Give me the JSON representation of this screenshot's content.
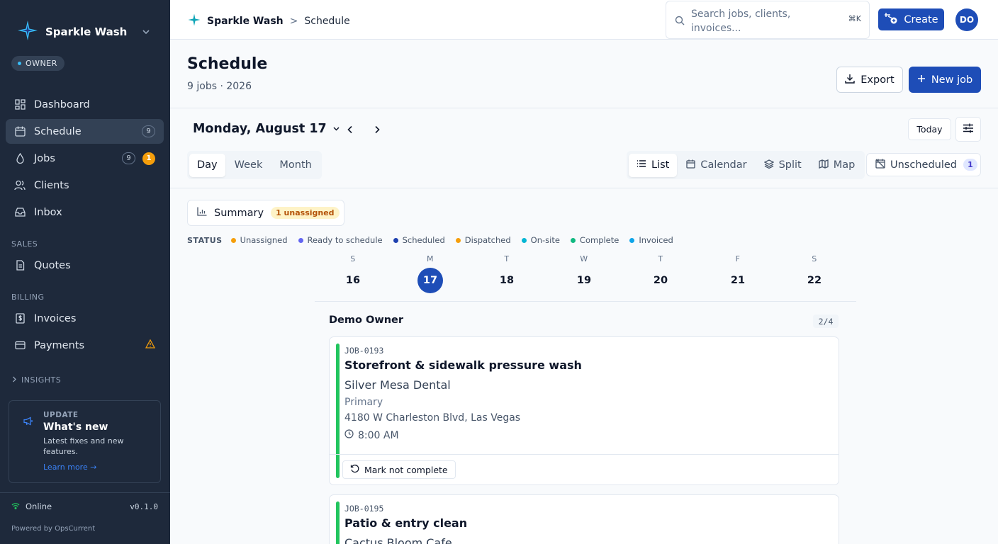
{
  "app": {
    "name": "Sparkle Wash",
    "role": "OWNER"
  },
  "sidebar": {
    "nav": [
      {
        "label": "Dashboard",
        "icon": "dashboard-icon"
      },
      {
        "label": "Schedule",
        "icon": "calendar-icon",
        "count": "9",
        "active": true
      },
      {
        "label": "Jobs",
        "icon": "droplet-icon",
        "count": "9",
        "alert": "1"
      },
      {
        "label": "Clients",
        "icon": "users-icon"
      },
      {
        "label": "Inbox",
        "icon": "inbox-icon"
      }
    ],
    "sales_label": "SALES",
    "sales": [
      {
        "label": "Quotes",
        "icon": "document-icon"
      }
    ],
    "billing_label": "BILLING",
    "billing": [
      {
        "label": "Invoices",
        "icon": "dollar-file-icon"
      },
      {
        "label": "Payments",
        "icon": "credit-card-icon",
        "warning": true
      }
    ],
    "insights_label": "INSIGHTS",
    "update": {
      "tag": "UPDATE",
      "title": "What's new",
      "desc": "Latest fixes and new features.",
      "link": "Learn more →"
    },
    "status": "Online",
    "version": "v0.1.0",
    "powered": "Powered by OpsCurrent"
  },
  "topbar": {
    "breadcrumb_app": "Sparkle Wash",
    "breadcrumb_sep": ">",
    "breadcrumb_page": "Schedule",
    "search_placeholder": "Search jobs, clients, invoices...",
    "search_kbd": "⌘K",
    "create_label": "Create",
    "avatar": "DO"
  },
  "page": {
    "title": "Schedule",
    "subtitle": "9 jobs · 2026",
    "export_label": "Export",
    "new_job_label": "New job"
  },
  "toolbar": {
    "date_label": "Monday, August 17",
    "today_label": "Today",
    "range_tabs": [
      "Day",
      "Week",
      "Month"
    ],
    "view_tabs": [
      "List",
      "Calendar",
      "Split",
      "Map"
    ],
    "unscheduled_label": "Unscheduled",
    "unscheduled_count": "1"
  },
  "summary": {
    "label": "Summary",
    "badge": "1 unassigned"
  },
  "legend": {
    "title": "STATUS",
    "items": [
      {
        "label": "Unassigned",
        "color": "#f59e0b"
      },
      {
        "label": "Ready to schedule",
        "color": "#6366f1"
      },
      {
        "label": "Scheduled",
        "color": "#1e40af"
      },
      {
        "label": "Dispatched",
        "color": "#f59e0b"
      },
      {
        "label": "On-site",
        "color": "#06b6d4"
      },
      {
        "label": "Complete",
        "color": "#10b981"
      },
      {
        "label": "Invoiced",
        "color": "#0ea5e9"
      }
    ]
  },
  "week": [
    {
      "letter": "S",
      "num": "16"
    },
    {
      "letter": "M",
      "num": "17",
      "selected": true
    },
    {
      "letter": "T",
      "num": "18"
    },
    {
      "letter": "W",
      "num": "19"
    },
    {
      "letter": "T",
      "num": "20"
    },
    {
      "letter": "F",
      "num": "21"
    },
    {
      "letter": "S",
      "num": "22"
    }
  ],
  "group": {
    "name": "Demo Owner",
    "count": "2/4",
    "jobs": [
      {
        "id": "JOB-0193",
        "title": "Storefront & sidewalk pressure wash",
        "client": "Silver Mesa Dental",
        "location": "Primary",
        "address": "4180 W Charleston Blvd, Las Vegas",
        "time": "8:00 AM",
        "action": "Mark not complete",
        "status_color": "#22c55e"
      },
      {
        "id": "JOB-0195",
        "title": "Patio & entry clean",
        "client": "Cactus Bloom Cafe",
        "status_color": "#22c55e"
      }
    ]
  }
}
